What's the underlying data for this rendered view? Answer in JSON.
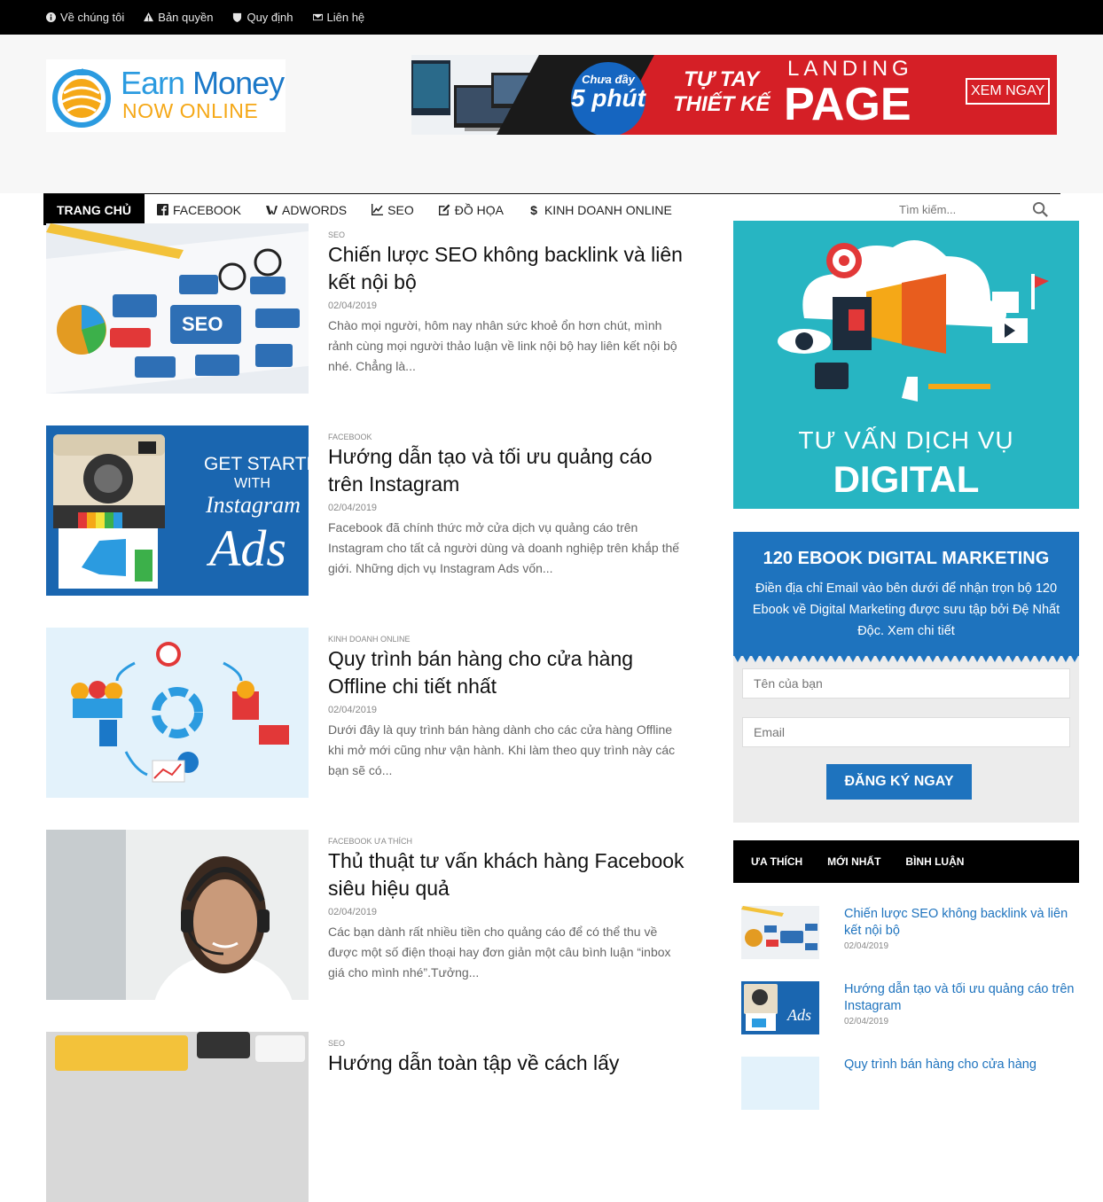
{
  "topbar": {
    "links": [
      {
        "label": "Về chúng tôi",
        "icon": "info-icon"
      },
      {
        "label": "Bản quyền",
        "icon": "warning-icon"
      },
      {
        "label": "Quy định",
        "icon": "shield-icon"
      },
      {
        "label": "Liên hệ",
        "icon": "envelope-icon"
      }
    ]
  },
  "logo": {
    "line1a": "Earn",
    "line1b": "Money",
    "line2": "NOW ONLINE"
  },
  "banner": {
    "badge_top": "Chưa đầy",
    "badge_main": "5 phút",
    "tagline_1": "TỰ TAY",
    "tagline_2": "THIẾT KẾ",
    "landing": "LANDING",
    "page": "PAGE",
    "cta": "XEM NGAY"
  },
  "nav": {
    "items": [
      {
        "label": "TRANG CHỦ"
      },
      {
        "label": "FACEBOOK"
      },
      {
        "label": "ADWORDS"
      },
      {
        "label": "SEO"
      },
      {
        "label": "ĐỒ HỌA"
      },
      {
        "label": "KINH DOANH ONLINE"
      }
    ],
    "search_placeholder": "Tìm kiếm..."
  },
  "posts": [
    {
      "category": "SEO",
      "title": "Chiến lược SEO không backlink và liên kết nội bộ",
      "date": "02/04/2019",
      "excerpt": "Chào mọi người, hôm nay nhân sức khoẻ ổn hơn chút, mình rảnh cùng mọi người thảo luận về link nội bộ hay liên kết nội bộ nhé. Chẳng là..."
    },
    {
      "category": "FACEBOOK",
      "title": "Hướng dẫn tạo và tối ưu quảng cáo trên Instagram",
      "date": "02/04/2019",
      "excerpt": "Facebook đã chính thức mở cửa dịch vụ quảng cáo trên Instagram cho tất cả người dùng và doanh nghiệp trên khắp thế giới. Những dịch vụ Instagram Ads vốn...",
      "thumb_text": {
        "l1": "GET STARTED",
        "l2": "WITH",
        "l3": "Instagram",
        "l4": "Ads"
      }
    },
    {
      "category": "KINH DOANH ONLINE",
      "title": "Quy trình bán hàng cho cửa hàng Offline chi tiết nhất",
      "date": "02/04/2019",
      "excerpt": "Dưới đây là quy trình bán hàng dành cho các cửa hàng Offline khi mở mới cũng như vận hành. Khi làm theo quy trình này các bạn sẽ có..."
    },
    {
      "category": "FACEBOOK ƯA THÍCH",
      "title": "Thủ thuật tư vấn khách hàng Facebook siêu hiệu quả",
      "date": "02/04/2019",
      "excerpt": "Các bạn dành rất nhiều tiền cho quảng cáo để có thể thu về được một số điện thoại hay đơn giản một câu bình luận “inbox giá cho mình nhé”.Tưởng..."
    },
    {
      "category": "SEO",
      "title": "Hướng dẫn toàn tập về cách lấy",
      "date": "",
      "excerpt": ""
    }
  ],
  "sidebar": {
    "ad": {
      "line1": "TƯ VẤN DỊCH VỤ",
      "line2": "DIGITAL MARKETING"
    },
    "ebook": {
      "title": "120 EBOOK DIGITAL MARKETING",
      "desc": "Điền địa chỉ Email vào bên dưới để nhận trọn bộ 120 Ebook về Digital Marketing được sưu tập bởi Đệ Nhất Độc. Xem chi tiết",
      "name_placeholder": "Tên của bạn",
      "email_placeholder": "Email",
      "button": "ĐĂNG KÝ NGAY"
    },
    "tabs": [
      "ƯA THÍCH",
      "MỚI NHẤT",
      "BÌNH LUẬN"
    ],
    "widget_posts": [
      {
        "title": "Chiến lược SEO không backlink và liên kết nội bộ",
        "date": "02/04/2019"
      },
      {
        "title": "Hướng dẫn tạo và tối ưu quảng cáo trên Instagram",
        "date": "02/04/2019"
      },
      {
        "title": "Quy trình bán hàng cho cửa hàng",
        "date": ""
      }
    ]
  },
  "colors": {
    "accent": "#1e73be",
    "topbar": "#000000",
    "banner_red": "#d51f26",
    "ad_teal": "#27b5c2"
  }
}
